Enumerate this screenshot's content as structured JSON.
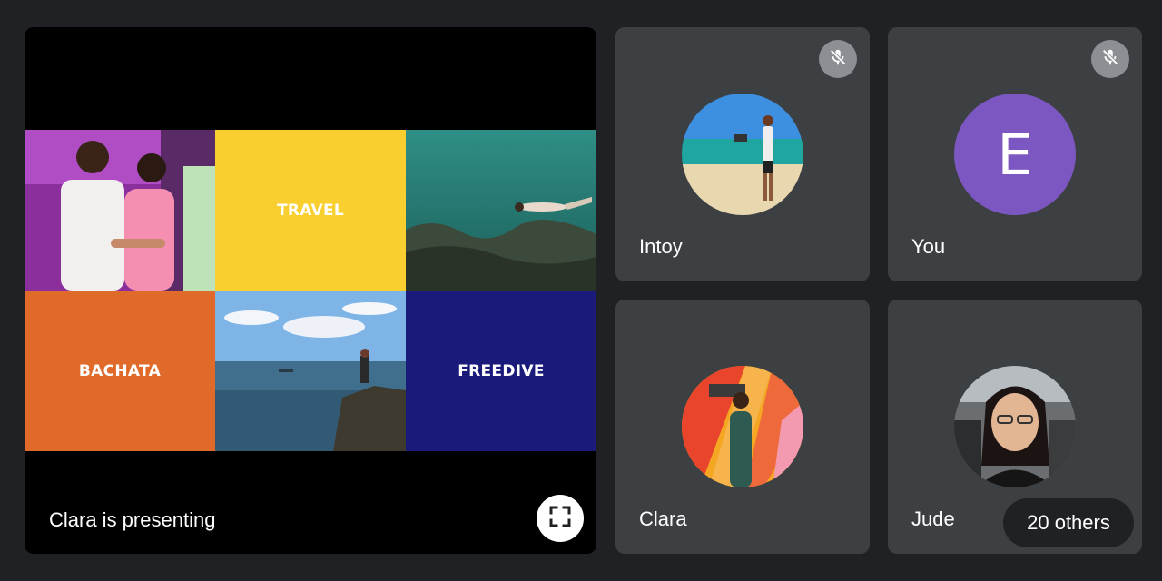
{
  "presentation": {
    "caption": "Clara is presenting",
    "fullscreen_icon": "fullscreen-icon",
    "slide_labels": {
      "travel": "TRAVEL",
      "bachata": "BACHATA",
      "freedive": "FREEDIVE"
    },
    "slide_colors": {
      "travel": "#f9cf2f",
      "bachata": "#e06a2a",
      "freedive": "#1a1a7a"
    }
  },
  "participants": [
    {
      "name": "Intoy",
      "muted": true,
      "avatar": "photo"
    },
    {
      "name": "You",
      "muted": true,
      "avatar": "letter",
      "letter": "E",
      "color": "#7d57c1"
    },
    {
      "name": "Clara",
      "muted": false,
      "avatar": "photo"
    },
    {
      "name": "Jude",
      "muted": false,
      "avatar": "photo"
    }
  ],
  "others_button": {
    "label": "20 others"
  },
  "colors": {
    "background": "#202124",
    "tile": "#3c4043",
    "mute_badge": "#8c8f93"
  }
}
